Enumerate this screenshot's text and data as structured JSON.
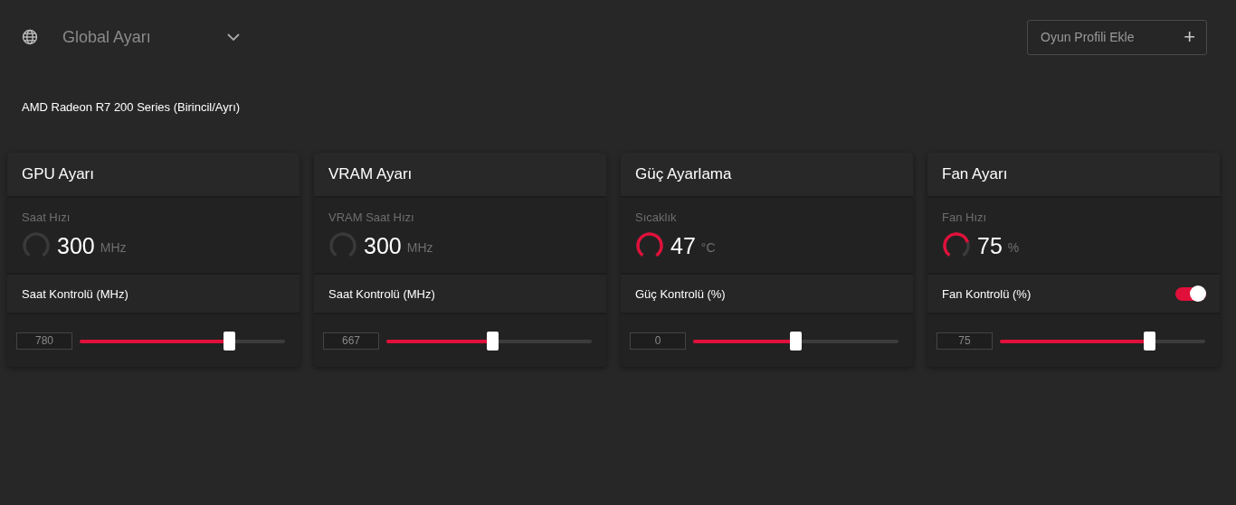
{
  "profile_select": {
    "value": "Global Ayarı"
  },
  "add_button": {
    "label": "Oyun Profili Ekle",
    "icon": "+"
  },
  "device_name": "AMD Radeon R7 200 Series (Birincil/Ayrı)",
  "cards": [
    {
      "title": "GPU Ayarı",
      "metric_label": "Saat Hızı",
      "metric_value": "300",
      "metric_unit": "MHz",
      "control_label": "Saat Kontrolü (MHz)",
      "input_value": "780",
      "level": 0.73
    },
    {
      "title": "VRAM Ayarı",
      "metric_label": "VRAM Saat Hızı",
      "metric_value": "300",
      "metric_unit": "MHz",
      "control_label": "Saat Kontrolü (MHz)",
      "input_value": "667",
      "level": 0.52
    },
    {
      "title": "Güç Ayarlama",
      "metric_label": "Sıcaklık",
      "metric_value": "47",
      "metric_unit": "°C",
      "control_label": "Güç Kontrolü (%)",
      "input_value": "0",
      "level": 0.5
    },
    {
      "title": "Fan Ayarı",
      "metric_label": "Fan Hızı",
      "metric_value": "75",
      "metric_unit": "%",
      "control_label": "Fan Kontrolü (%)",
      "toggle": {
        "on": true
      },
      "input_value": "75",
      "level": 0.73
    }
  ]
}
